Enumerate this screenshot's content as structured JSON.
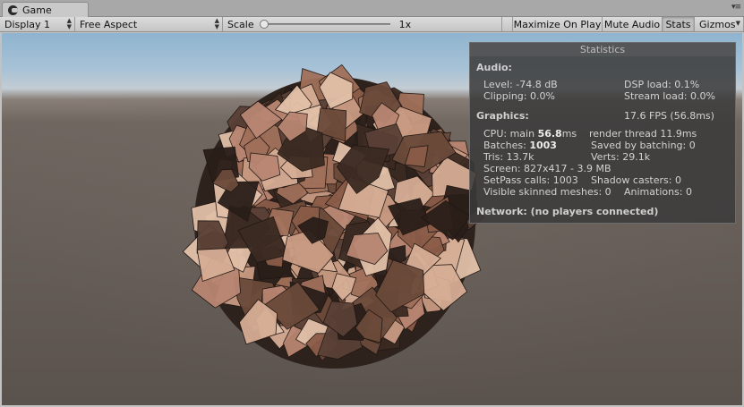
{
  "tab": {
    "label": "Game"
  },
  "toolbar": {
    "display": "Display 1",
    "aspect": "Free Aspect",
    "scale_label": "Scale",
    "scale_value": "1x",
    "maximize": "Maximize On Play",
    "mute": "Mute Audio",
    "stats": "Stats",
    "gizmos": "Gizmos"
  },
  "stats": {
    "title": "Statistics",
    "audio_header": "Audio:",
    "level": "Level: -74.8 dB",
    "dsp": "DSP load: 0.1%",
    "clipping": "Clipping: 0.0%",
    "stream": "Stream load: 0.0%",
    "graphics_header": "Graphics:",
    "fps": "17.6 FPS (56.8ms)",
    "cpu_main_label": "CPU: main ",
    "cpu_main_value": "56.8",
    "cpu_main_unit": "ms",
    "render_thread": "render thread 11.9ms",
    "batches_label": "Batches: ",
    "batches_value": "1003",
    "saved_batching": "Saved by batching: 0",
    "tris": "Tris: 13.7k",
    "verts": "Verts: 29.1k",
    "screen": "Screen: 827x417 - 3.9 MB",
    "setpass": "SetPass calls: 1003",
    "shadow": "Shadow casters: 0",
    "skinned": "Visible skinned meshes: 0",
    "animations": "Animations: 0",
    "network": "Network: (no players connected)"
  },
  "colors": {
    "panel_bg": "#3a3a3a",
    "sky": "#a7c2d6",
    "ground": "#5a524d"
  }
}
